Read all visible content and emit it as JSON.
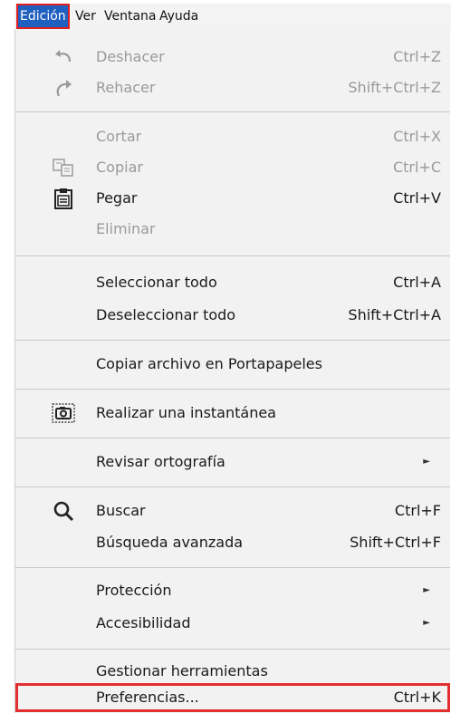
{
  "menubar": {
    "items": [
      {
        "label": "Edición"
      },
      {
        "label": "Ver"
      },
      {
        "label": "Ventana"
      },
      {
        "label": "Ayuda"
      }
    ]
  },
  "menu": {
    "undo": {
      "label": "Deshacer",
      "shortcut": "Ctrl+Z",
      "icon": "undo-icon"
    },
    "redo": {
      "label": "Rehacer",
      "shortcut": "Shift+Ctrl+Z",
      "icon": "redo-icon"
    },
    "cut": {
      "label": "Cortar",
      "shortcut": "Ctrl+X"
    },
    "copy": {
      "label": "Copiar",
      "shortcut": "Ctrl+C",
      "icon": "copy-icon"
    },
    "paste": {
      "label": "Pegar",
      "shortcut": "Ctrl+V",
      "icon": "clipboard-icon"
    },
    "delete": {
      "label": "Eliminar"
    },
    "select_all": {
      "label": "Seleccionar todo",
      "shortcut": "Ctrl+A"
    },
    "deselect_all": {
      "label": "Deseleccionar todo",
      "shortcut": "Shift+Ctrl+A"
    },
    "copy_file": {
      "label": "Copiar archivo en Portapapeles"
    },
    "snapshot": {
      "label": "Realizar una instantánea",
      "icon": "camera-icon"
    },
    "spellcheck": {
      "label": "Revisar ortografía"
    },
    "search": {
      "label": "Buscar",
      "shortcut": "Ctrl+F",
      "icon": "search-icon"
    },
    "advanced_search": {
      "label": "Búsqueda avanzada",
      "shortcut": "Shift+Ctrl+F"
    },
    "protection": {
      "label": "Protección"
    },
    "accessibility": {
      "label": "Accesibilidad"
    },
    "manage_tools": {
      "label": "Gestionar herramientas"
    },
    "preferences": {
      "label": "Preferencias...",
      "shortcut": "Ctrl+K"
    }
  },
  "colors": {
    "active_menu_bg": "#1f5fbf",
    "highlight_border": "#e23030",
    "disabled_text": "#9a9a9a"
  }
}
